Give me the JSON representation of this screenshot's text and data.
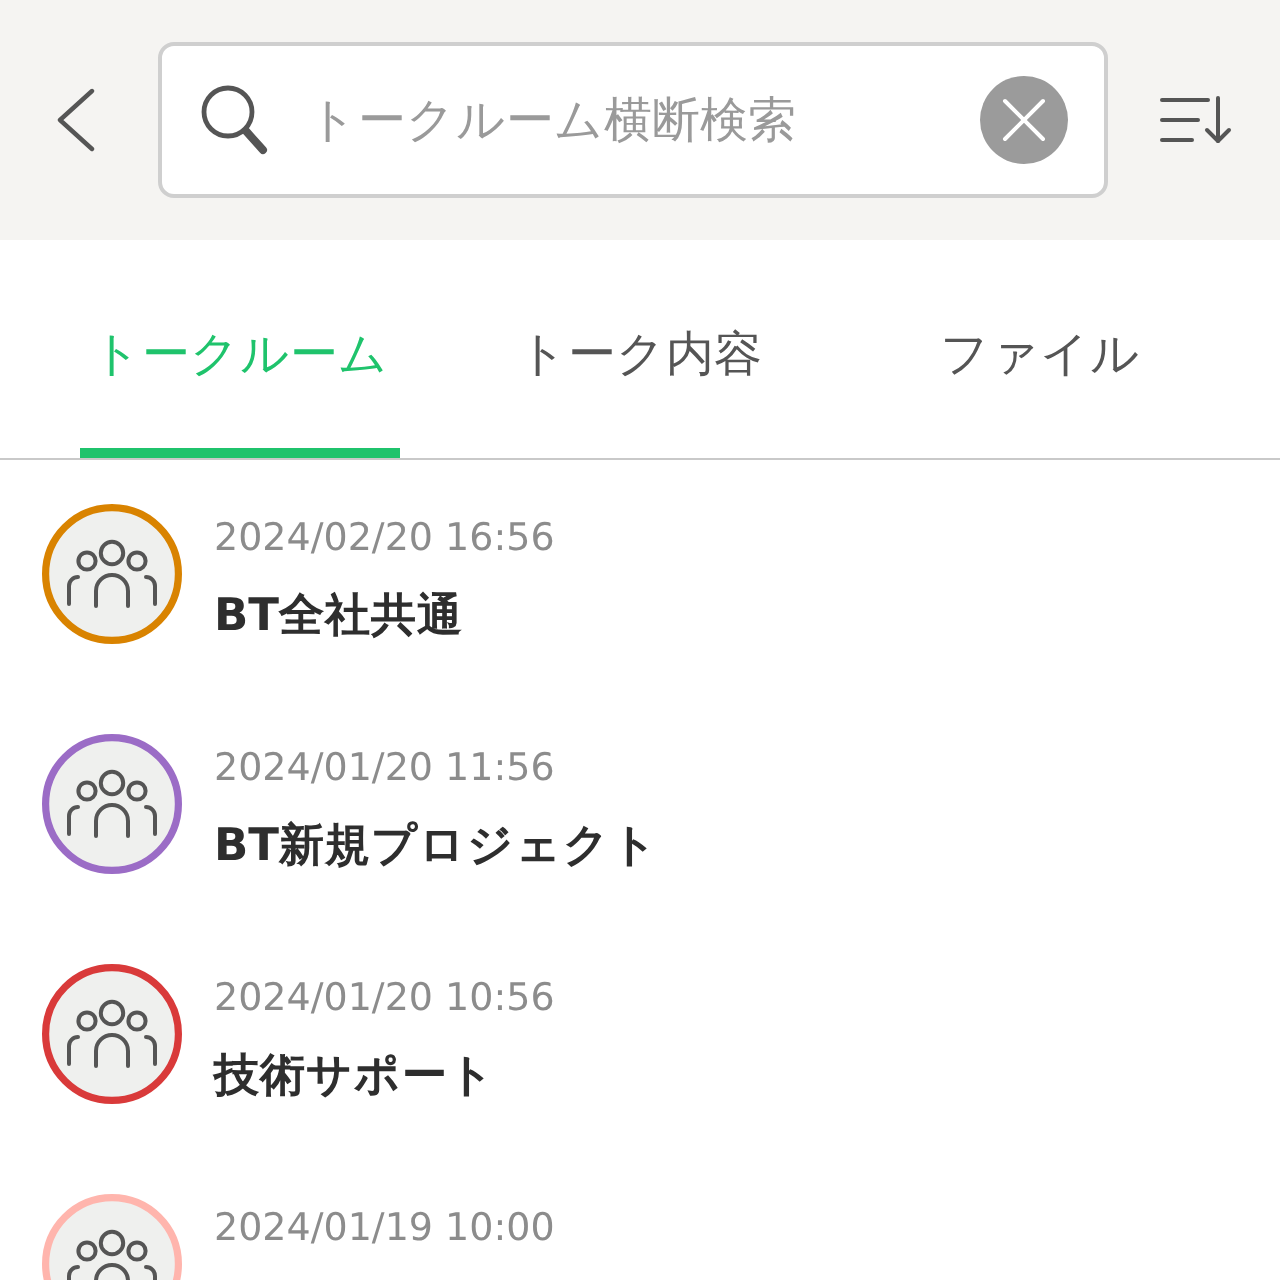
{
  "header": {
    "search": {
      "placeholder": "トークルーム横断検索"
    }
  },
  "tabs": [
    {
      "label": "トークルーム",
      "selected": true
    },
    {
      "label": "トーク内容",
      "selected": false
    },
    {
      "label": "ファイル",
      "selected": false
    }
  ],
  "rooms": [
    {
      "time": "2024/02/20 16:56",
      "name": "BT全社共通",
      "color": "#d98300"
    },
    {
      "time": "2024/01/20 11:56",
      "name": "BT新規プロジェクト",
      "color": "#9b6cc6"
    },
    {
      "time": "2024/01/20 10:56",
      "name": "技術サポート",
      "color": "#d93a3a"
    },
    {
      "time": "2024/01/19 10:00",
      "color": "#ffb5ad"
    }
  ]
}
